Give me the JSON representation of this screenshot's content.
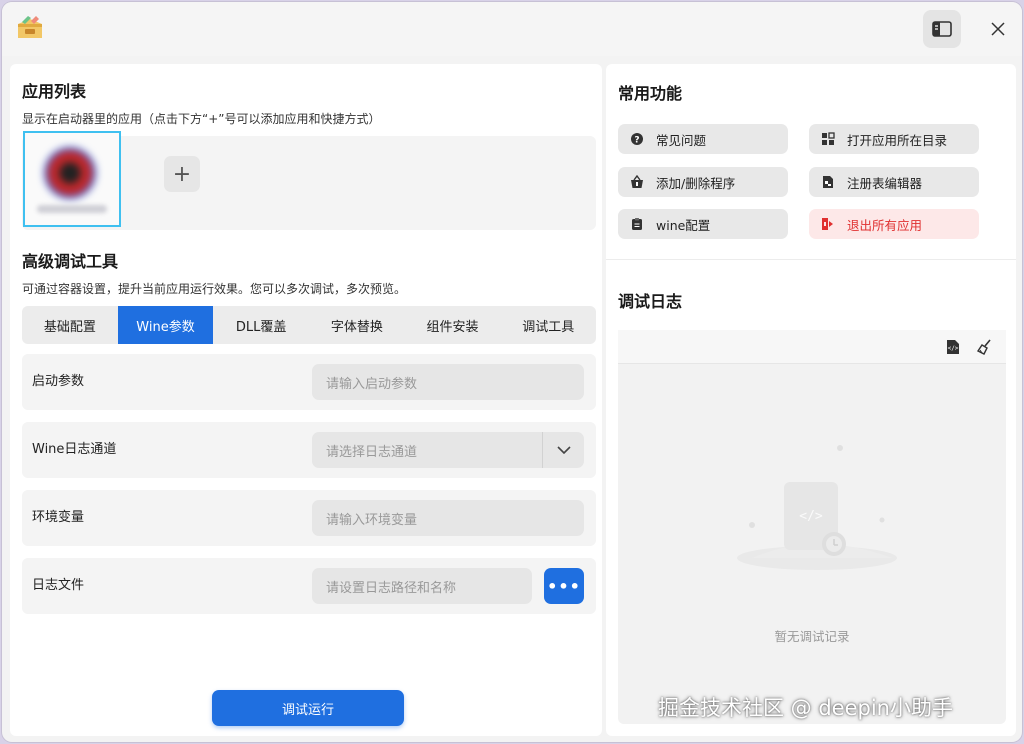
{
  "window": {
    "app_icon": "package-box-icon",
    "sidebar_toggle_icon": "sidebar-icon",
    "close_icon": "close-icon"
  },
  "app_list": {
    "title": "应用列表",
    "subtitle": "显示在启动器里的应用（点击下方“+”号可以添加应用和快捷方式）",
    "add_label": "+"
  },
  "advanced": {
    "title": "高级调试工具",
    "subtitle": "可通过容器设置，提升当前应用运行效果。您可以多次调试，多次预览。",
    "tabs": [
      {
        "label": "基础配置",
        "active": false
      },
      {
        "label": "Wine参数",
        "active": true
      },
      {
        "label": "DLL覆盖",
        "active": false
      },
      {
        "label": "字体替换",
        "active": false
      },
      {
        "label": "组件安装",
        "active": false
      },
      {
        "label": "调试工具",
        "active": false
      }
    ],
    "rows": [
      {
        "label": "启动参数",
        "placeholder": "请输入启动参数"
      },
      {
        "label": "Wine日志通道",
        "placeholder": "请选择日志通道"
      },
      {
        "label": "环境变量",
        "placeholder": "请输入环境变量"
      },
      {
        "label": "日志文件",
        "placeholder": "请设置日志路径和名称",
        "more_label": "•••"
      }
    ],
    "run_label": "调试运行"
  },
  "common": {
    "title": "常用功能",
    "buttons": [
      {
        "label": "常见问题",
        "icon": "question-icon"
      },
      {
        "label": "打开应用所在目录",
        "icon": "folder-grid-icon"
      },
      {
        "label": "添加/删除程序",
        "icon": "basket-icon"
      },
      {
        "label": "注册表编辑器",
        "icon": "registry-file-icon"
      },
      {
        "label": "wine配置",
        "icon": "clipboard-icon"
      },
      {
        "label": "退出所有应用",
        "icon": "exit-icon",
        "danger": true
      }
    ]
  },
  "log": {
    "title": "调试日志",
    "empty_text": "暂无调试记录"
  },
  "watermark": "掘金技术社区 @ deepin小助手",
  "colors": {
    "accent": "#1f6fe0",
    "danger": "#e03030",
    "danger_bg": "#fde8e8",
    "selection": "#3fc0f0"
  }
}
